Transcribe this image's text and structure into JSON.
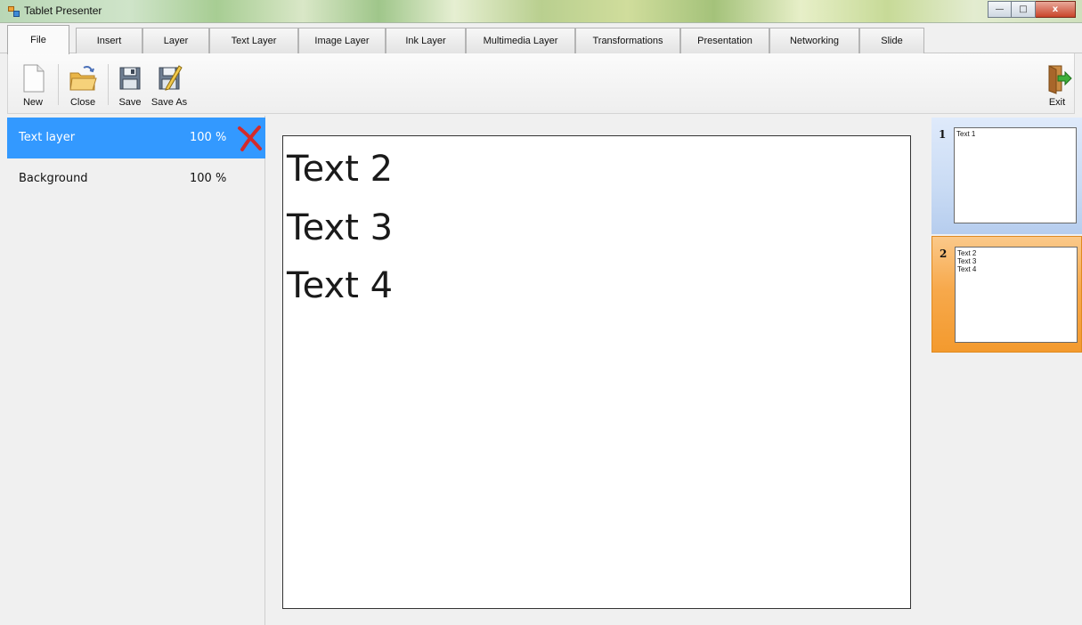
{
  "window": {
    "title": "Tablet Presenter",
    "controls": {
      "minimize": "—",
      "maximize": "□",
      "close": "x"
    }
  },
  "tabs": [
    {
      "label": "File",
      "active": true
    },
    {
      "label": "Insert"
    },
    {
      "label": "Layer"
    },
    {
      "label": "Text Layer"
    },
    {
      "label": "Image Layer"
    },
    {
      "label": "Ink Layer"
    },
    {
      "label": "Multimedia Layer"
    },
    {
      "label": "Transformations"
    },
    {
      "label": "Presentation"
    },
    {
      "label": "Networking"
    },
    {
      "label": "Slide"
    }
  ],
  "toolbar": {
    "new_label": "New",
    "close_label": "Close",
    "save_label": "Save",
    "save_as_label": "Save As",
    "exit_label": "Exit"
  },
  "layers": [
    {
      "name": "Text layer",
      "opacity": "100 %",
      "selected": true
    },
    {
      "name": "Background",
      "opacity": "100 %"
    }
  ],
  "canvas": {
    "lines": [
      "Text 2",
      "Text 3",
      "Text 4"
    ]
  },
  "slides": [
    {
      "number": "1",
      "lines": [
        "Text 1"
      ]
    },
    {
      "number": "2",
      "lines": [
        "Text 2",
        "Text 3",
        "Text 4"
      ],
      "selected": true
    }
  ],
  "colors": {
    "selection": "#3399ff",
    "active_slide": "#f7a94c",
    "inactive_slide": "#c9dbf4"
  },
  "icons": {
    "app": "app-icon",
    "new": "new-document-icon",
    "close": "open-folder-icon",
    "save": "floppy-disk-icon",
    "save_as": "floppy-pencil-icon",
    "exit": "exit-door-icon",
    "delete_layer": "red-x-icon"
  }
}
